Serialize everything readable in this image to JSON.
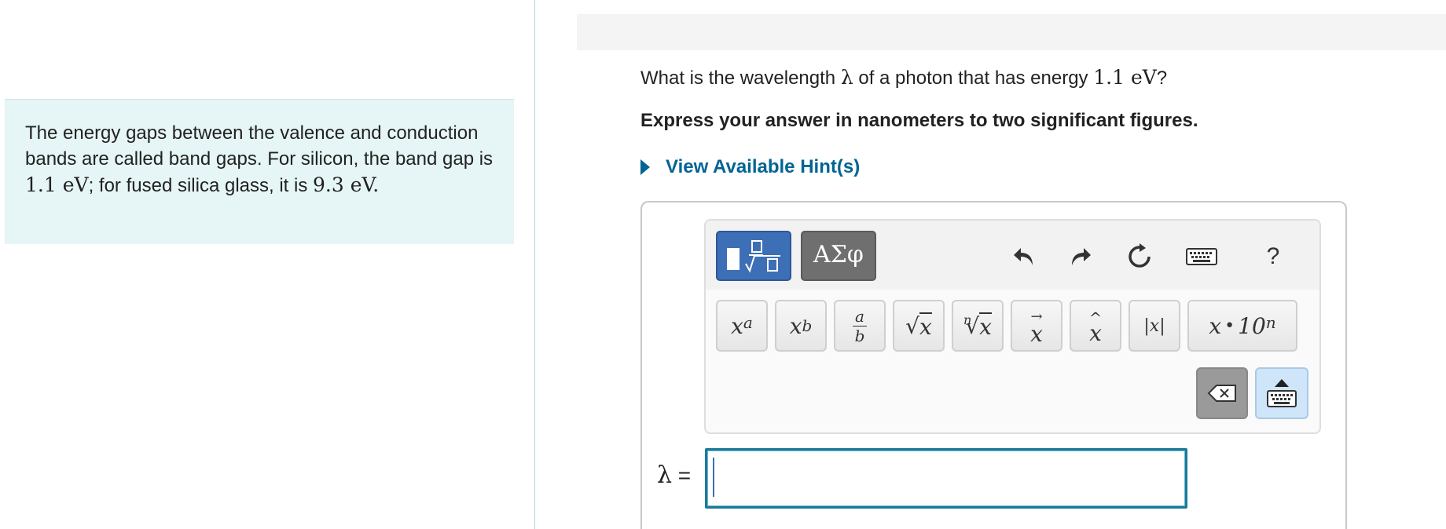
{
  "intro": {
    "text_1": "The energy gaps between the valence and conduction bands are called band gaps. For silicon, the band gap is ",
    "value_si": "1.1 eV",
    "text_2": "; for fused silica glass, it is ",
    "value_glass": "9.3 eV",
    "text_3": "."
  },
  "question": {
    "prefix": "What is the wavelength ",
    "symbol": "λ",
    "middle": " of a photon that has energy ",
    "energy": "1.1 eV",
    "suffix": "?"
  },
  "instruction": "Express your answer in nanometers to two significant figures.",
  "hint_label": "View Available Hint(s)",
  "toolbar": {
    "mode_greek_label": "ΑΣφ",
    "help_label": "?",
    "undo_icon": "undo-icon",
    "redo_icon": "redo-icon",
    "reset_icon": "reset-icon",
    "keyboard_icon": "keyboard-icon"
  },
  "keys": {
    "superscript": {
      "base": "x",
      "sup": "a"
    },
    "subscript": {
      "base": "x",
      "sub": "b"
    },
    "fraction": {
      "num": "a",
      "den": "b"
    },
    "sqrt": {
      "radicand": "x"
    },
    "nth_root": {
      "index": "n",
      "radicand": "x"
    },
    "vector": {
      "base": "x"
    },
    "hat": {
      "base": "x"
    },
    "abs": {
      "label": "|x|"
    },
    "sci": {
      "base": "x",
      "dot": "•",
      "ten": "10",
      "exp": "n"
    }
  },
  "answer": {
    "label_symbol": "λ",
    "label_eq": " =",
    "value": ""
  },
  "colors": {
    "intro_bg": "#e6f5f5",
    "hint_blue": "#006494",
    "mode_math_bg": "#3d6fb6",
    "mode_greek_bg": "#6f6f6f",
    "answer_border": "#1a7a99"
  }
}
